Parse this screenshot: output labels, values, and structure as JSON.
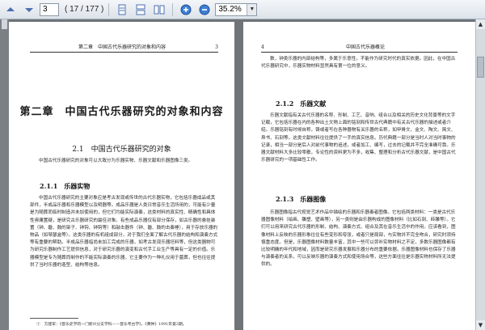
{
  "toolbar": {
    "current_page": "3",
    "page_total": "( 17 / 177 )",
    "zoom": "35.2%",
    "zoom_arrow": "▼"
  },
  "left_page": {
    "header_left": "第二章　中国古代乐器研究的对象和内容",
    "header_right": "3",
    "chapter_title": "第二章　中国古代乐器研究的对象和内容",
    "section_title": "2.1　中国古代乐器研究的对象",
    "intro": "中国古代乐器研究的对象可以大致分为乐器实物、乐器文献和乐器图像三类。",
    "subsection": "2.1.1　乐器实物",
    "body": "中国古代乐器研究的主要对象应是考古发现或传世的古代乐器实物，它包括乐器成品或其部件，半成品乐器和乐器模型以及明器等。成品乐器是人类日常音乐生活所用的，可能有少量是为随葬而临时制造并未加使用的，但它们均能实际演奏，这类材料的真实性、精确性和具体性毋庸置疑，是研究古乐器研究的最佳对象。有些成品乐器仅有部分保存，如古乐器的悬挂装置（钟、磬、鼓的架子、钟钩、钟钩等）和敲击器件（钟、磬、鼓的击奏棰），用于存放乐器的物品（如琴瑟盒等）。这类乐器的有机组成部分，对于我们全面了解古代乐器的结构和演奏方式等有重要的帮助。半成品乐器指尚未加工完成的乐器，如考古发现乐器坯料等，但这类器物可为研究乐器制作工艺提供信息，对于研究乐器的演变和古代手工业生产等具有一定的价值。乐器模型是专为随葬而制作的不能实际演奏的乐器，它主要作为一种礼仪用于墓葬，但也往往提供了当时乐器的造型、结构等信息。",
    "footnote": "①　方建军：《音乐史学的一门新兴分支学科——音乐考古学》，《黄钟》1991年第3期。"
  },
  "right_page": {
    "header_left": "4",
    "header_center": "中国古代乐器概论",
    "body_top": "数，钟类乐器的内部结构等，多属于乐意性，不能作为研究时代的真实依据。因此，在中国古代乐器研究中，乐器实物材料显然具有第一位的意义。",
    "sub1": "2.1.2　乐器文献",
    "body1": "乐器文献指有关古代乐器的名称、形制、工艺、音响、组合以及相关的历史文化背景等的文字记载，它包括乐器在内的各种出土文物上面的铭刻和传世古代典籍中有关古代乐器的描述或者介绍。乐器铭刻有时候自称，铸或者写在各种器物有关乐器的名称，如甲骨文、金文、陶文、简文、帛书、石刻等。这类文献材料往往提供了一手的真实信息。历代典籍一部分是当时人对当时事物的记录，相当一部分是后人对前代事物的追述，或者加工、编写，过去的记载并不完全准确可靠。乐器文献材料大多比较零散，专论性的资料更为不多，收集、整理和分析古代乐器文献，是中国古代乐器研究的一项基础性工作。",
    "sub2": "2.1.3　乐器图像",
    "body2": "乐器图像指古代视觉艺术作品中描绘的乐器和乐器奏者图像。它包括两类材料：一类是古代乐器图像材料（绘画、雕塑、壁画等），另一类则是由乐器构成的图像材料（比如石刻、砖雕等）。它们可以用来研究古代乐器的形制、结构、演奏方式、组合及其在音乐生活中的作用。应该看到，图像材料上反映的乐器形象往往有些变形和夸张，或者只是局部，与实物并不完全吻合，研究时须持慎重态度。但是，乐器图像材料数量丰富，其中一些可以弥补实物材料之不足，多数乐器图像都有比较明确的年代和地域，因而是研究乐器发展和乐器分布的重要依据。乐器图像材料也保存了乐器与演奏者的关系，可以反映乐器的演奏方式和使用场合等，这些方面往往是乐器实物材料所无法提供的。"
  }
}
